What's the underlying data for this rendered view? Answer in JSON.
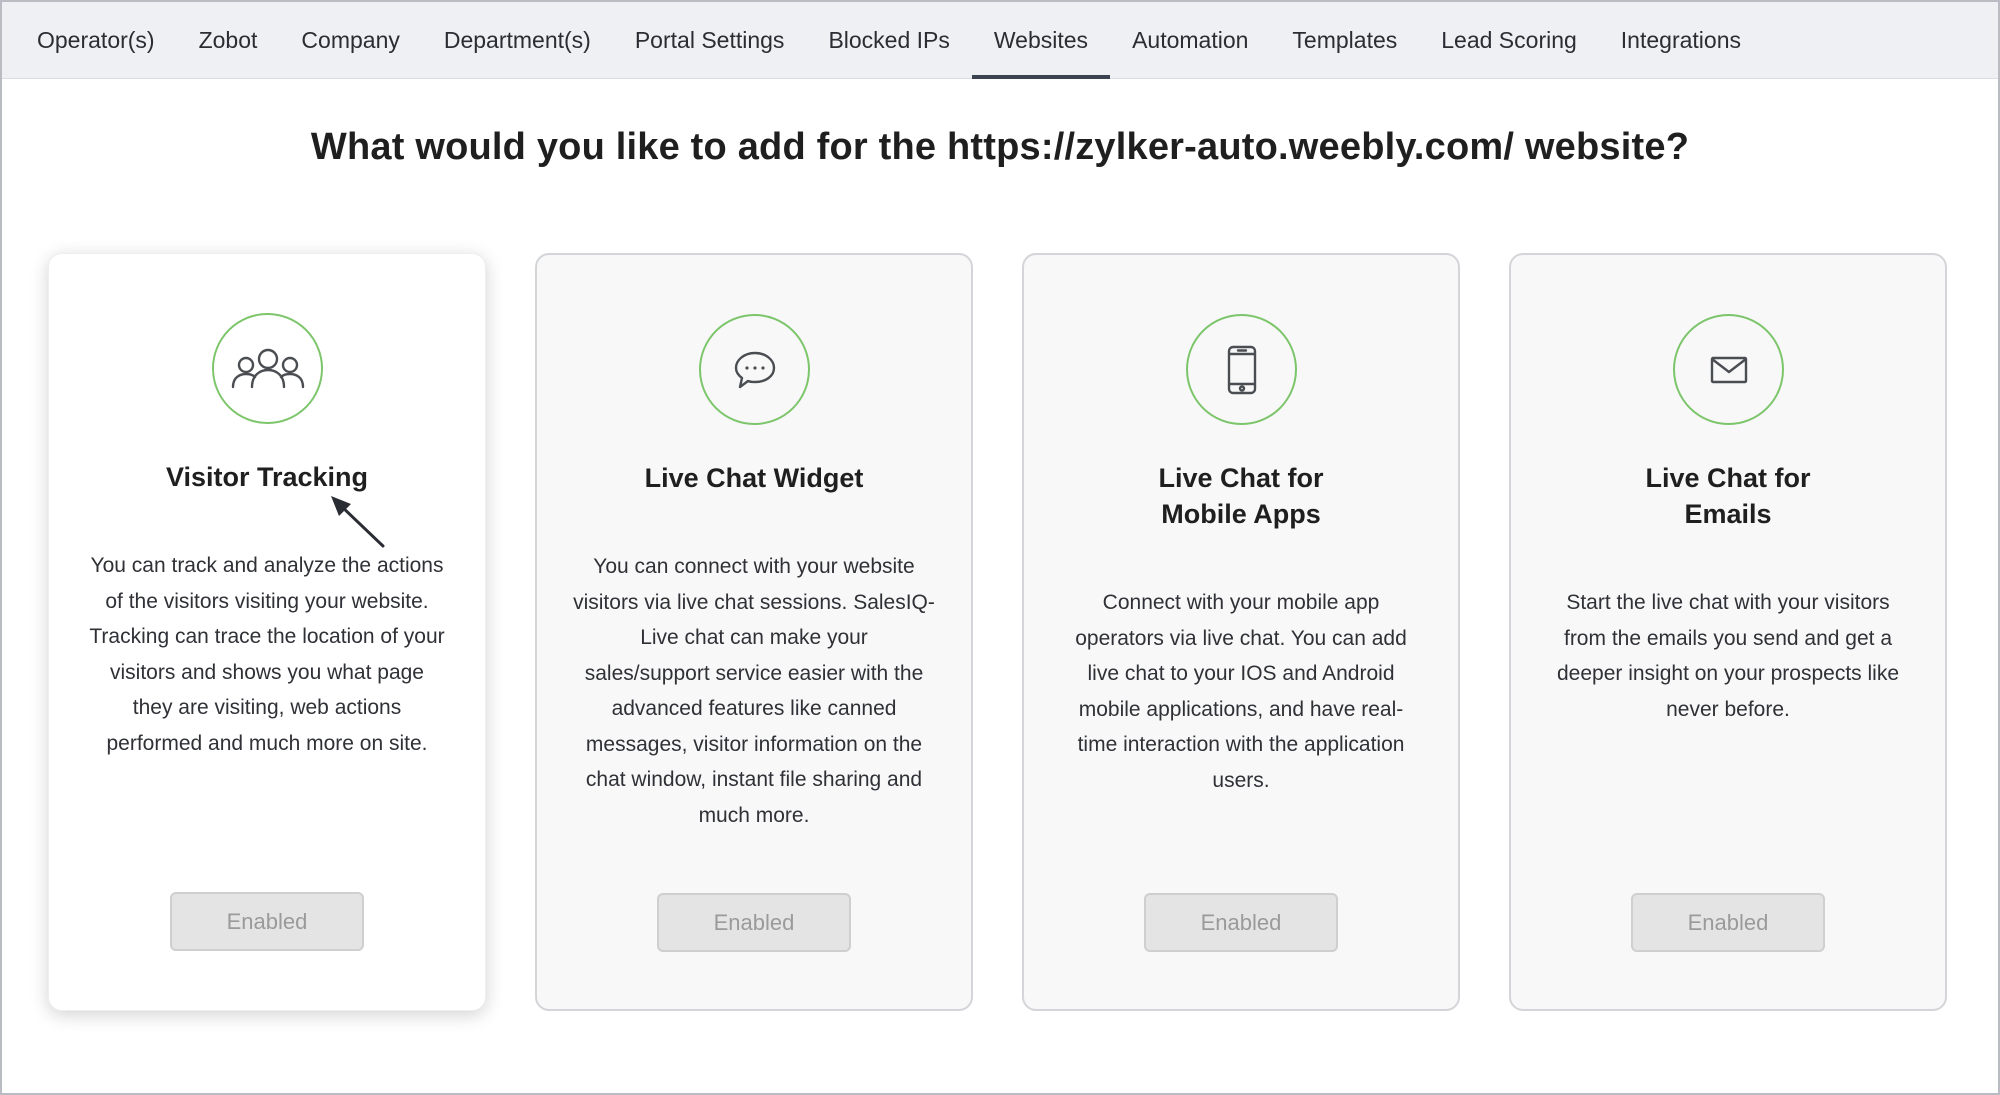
{
  "nav": {
    "tabs": [
      {
        "label": "Operator(s)"
      },
      {
        "label": "Zobot"
      },
      {
        "label": "Company"
      },
      {
        "label": "Department(s)"
      },
      {
        "label": "Portal Settings"
      },
      {
        "label": "Blocked IPs"
      },
      {
        "label": "Websites",
        "active": true
      },
      {
        "label": "Automation"
      },
      {
        "label": "Templates"
      },
      {
        "label": "Lead Scoring"
      },
      {
        "label": "Integrations"
      }
    ]
  },
  "heading": "What would you like to add for the https://zylker-auto.weebly.com/ website?",
  "cards": [
    {
      "icon": "visitors-icon",
      "title_lines": [
        "Visitor Tracking"
      ],
      "desc_lines": [
        "You can track and analyze the actions",
        "of the visitors visiting your website.",
        "Tracking can trace the location of your",
        "visitors and shows you what page",
        "they are visiting, web actions",
        "performed and much more on site."
      ],
      "button": "Enabled"
    },
    {
      "icon": "chat-bubble-icon",
      "title_lines": [
        "Live Chat Widget"
      ],
      "desc_lines": [
        "You can connect with your website",
        "visitors via live chat sessions. SalesIQ-",
        "Live chat can make your",
        "sales/support service easier with the",
        "advanced features like canned",
        "messages, visitor information on the",
        "chat window, instant file sharing and",
        "much more."
      ],
      "button": "Enabled"
    },
    {
      "icon": "mobile-phone-icon",
      "title_lines": [
        "Live Chat for",
        "Mobile Apps"
      ],
      "desc_lines": [
        "Connect with your mobile app",
        "operators via live chat. You can add",
        "live chat to your IOS and Android",
        "mobile applications, and have real-",
        "time interaction with the application",
        "users."
      ],
      "button": "Enabled"
    },
    {
      "icon": "envelope-icon",
      "title_lines": [
        "Live Chat for",
        "Emails"
      ],
      "desc_lines": [
        "Start the live chat with your visitors",
        "from the emails you send and get a",
        "deeper insight on your prospects like",
        "never before."
      ],
      "button": "Enabled"
    }
  ],
  "colors": {
    "accent_green": "#7cc56b",
    "nav_bg": "#eef0f3",
    "active_tab_underline": "#3b4250",
    "button_bg": "#e4e4e4",
    "button_text": "#9a9a9a"
  }
}
